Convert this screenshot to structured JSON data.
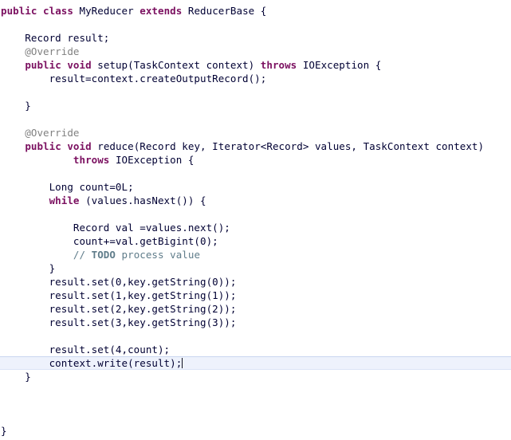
{
  "editor": {
    "language": "java",
    "colors": {
      "background": "#ffffff",
      "text": "#000033",
      "keyword": "#7b1060",
      "annotation": "#808080",
      "comment": "#5f7c8a",
      "current_line_highlight": "#eef2fc",
      "caret": "#101020"
    }
  },
  "code": {
    "line1": {
      "kw_public": "public",
      "kw_class": "class",
      "name": "MyReducer",
      "kw_extends": "extends",
      "base": "ReducerBase {",
      "sp1": " ",
      "sp2": " ",
      "sp3": " ",
      "sp4": " "
    },
    "line3": "    Record result;",
    "line4": "    @Override",
    "line5": {
      "indent": "    ",
      "kw_public": "public",
      "sp1": " ",
      "kw_void": "void",
      "mid": " setup(TaskContext context) ",
      "kw_throws": "throws",
      "tail": " IOException {"
    },
    "line6": "        result=context.createOutputRecord();",
    "line8": "    }",
    "line10": "    @Override",
    "line11": {
      "indent": "    ",
      "kw_public": "public",
      "sp1": " ",
      "kw_void": "void",
      "tail": " reduce(Record key, Iterator<Record> values, TaskContext context)"
    },
    "line12": {
      "indent": "            ",
      "kw_throws": "throws",
      "tail": " IOException {"
    },
    "line14": "        Long count=0L;",
    "line15": {
      "indent": "        ",
      "kw_while": "while",
      "tail": " (values.hasNext()) {"
    },
    "line17": "            Record val =values.next();",
    "line18": "            count+=val.getBigint(0);",
    "line19": {
      "indent": "            ",
      "slashes": "// ",
      "todo": "TODO",
      "tail": " process value"
    },
    "line20": "        }",
    "line21": "        result.set(0,key.getString(0));",
    "line22": "        result.set(1,key.getString(1));",
    "line23": "        result.set(2,key.getString(2));",
    "line24": "        result.set(3,key.getString(3));",
    "line26": "        result.set(4,count);",
    "line27": "        context.write(result);",
    "line28": "    }",
    "line31": "}"
  }
}
